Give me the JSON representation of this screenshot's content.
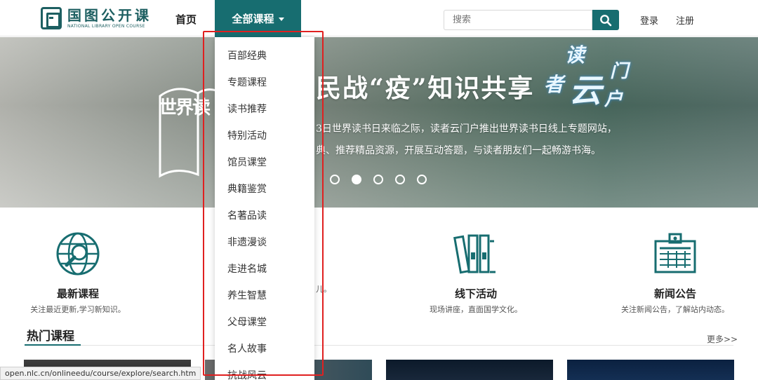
{
  "header": {
    "logo_cn": "国图公开课",
    "logo_en": "NATIONAL LIBRARY OPEN COURSE",
    "nav_home": "首页",
    "nav_all_courses": "全部课程",
    "search_placeholder": "搜索",
    "login": "登录",
    "register": "注册",
    "accent_color": "#176d70"
  },
  "banner": {
    "side_logo": "世界读",
    "title": "民战“疫”知识共享",
    "line1": "3日世界读书日来临之际，读者云门户推出世界读书日线上专题网站，",
    "line2": "典、推荐精品资源，开展互动答题，与读者朋友们一起畅游书海。",
    "brand_chars": [
      "读",
      "者",
      "云",
      "门",
      "户"
    ],
    "carousel_total": 5,
    "carousel_active": 2
  },
  "dropdown": {
    "items": [
      "百部经典",
      "专题课程",
      "读书推荐",
      "特别活动",
      "馆员课堂",
      "典籍鉴赏",
      "名著品读",
      "非遗漫谈",
      "走进名城",
      "养生智慧",
      "父母课堂",
      "名人故事",
      "抗战风云"
    ],
    "highlight_color": "#e02020"
  },
  "features": [
    {
      "title": "最新课程",
      "desc": "关注最近更新,学习新知识。",
      "icon": "globe-search-icon"
    },
    {
      "title": "",
      "desc": "儿。",
      "icon": "hidden"
    },
    {
      "title": "线下活动",
      "desc": "现场讲座，直面国学文化。",
      "icon": "books-icon"
    },
    {
      "title": "新闻公告",
      "desc": "关注新闻公告，了解站内动态。",
      "icon": "calendar-board-icon"
    }
  ],
  "hot": {
    "title": "热门课程",
    "more": "更多>>"
  },
  "status_bar": {
    "url": "open.nlc.cn/onlineedu/course/explore/search.htm"
  }
}
